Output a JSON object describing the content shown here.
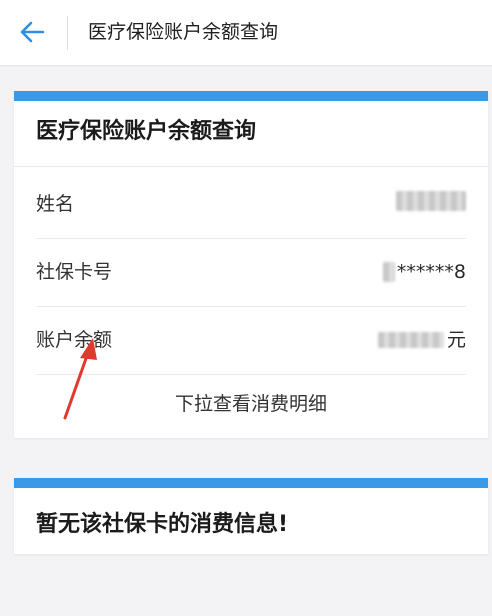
{
  "header": {
    "back_icon": "back-arrow-icon",
    "title": "医疗保险账户余额查询"
  },
  "account_card": {
    "heading": "医疗保险账户余额查询",
    "rows": [
      {
        "label": "姓名",
        "value": ""
      },
      {
        "label": "社保卡号",
        "value": "******8"
      },
      {
        "label": "账户余额",
        "value": "元"
      }
    ],
    "detail_link": "下拉查看消费明细"
  },
  "consumption_card": {
    "message": "暂无该社保卡的消费信息!"
  },
  "colors": {
    "accent": "#3a9ae8",
    "annotation_arrow": "#e03a2e"
  }
}
